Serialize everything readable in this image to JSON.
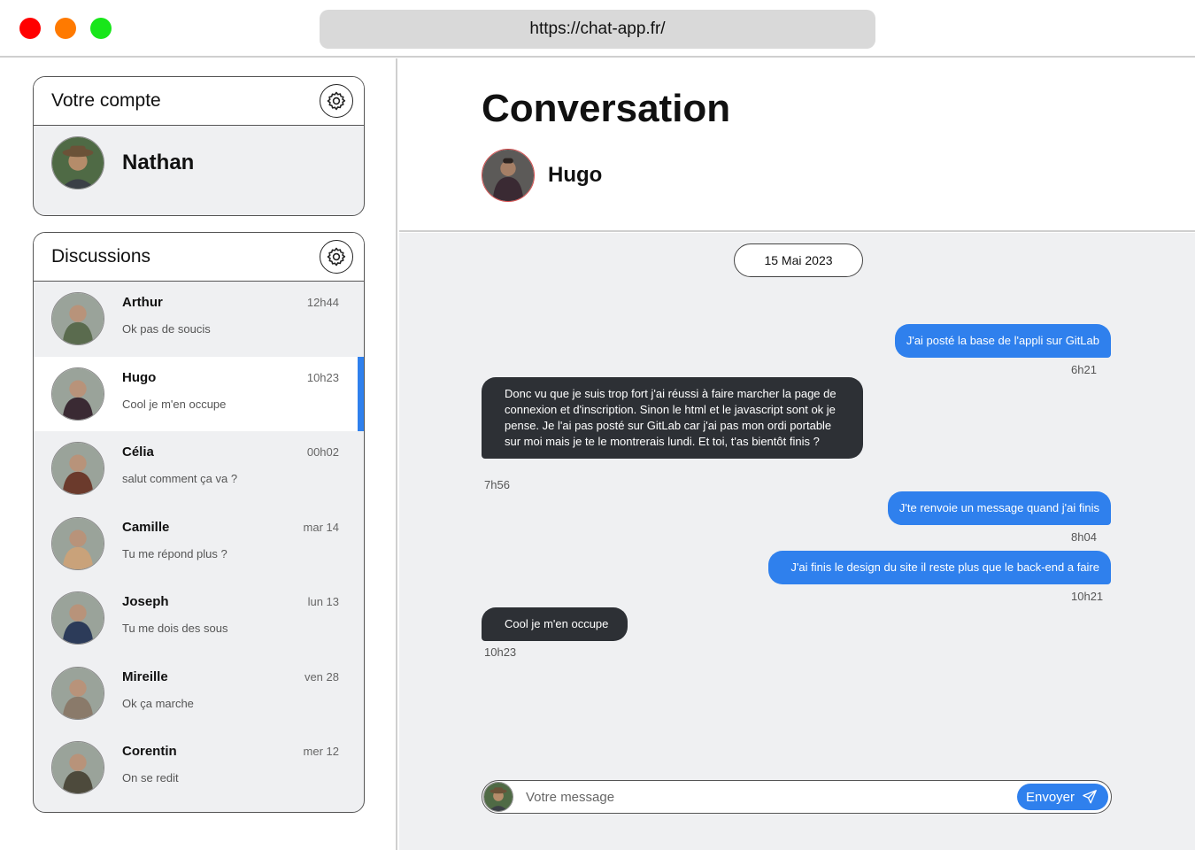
{
  "browser": {
    "url": "https://chat-app.fr/"
  },
  "account": {
    "header": "Votre compte",
    "name": "Nathan",
    "settings_icon": "gear-icon"
  },
  "discussions": {
    "header": "Discussions",
    "settings_icon": "gear-icon",
    "items": [
      {
        "name": "Arthur",
        "preview": "Ok pas de soucis",
        "time": "12h44",
        "color": "#5a6b4e"
      },
      {
        "name": "Hugo",
        "preview": "Cool je m'en occupe",
        "time": "10h23",
        "color": "#3a2a33",
        "active": true
      },
      {
        "name": "Célia",
        "preview": "salut comment ça va ?",
        "time": "00h02",
        "color": "#6b3a2c"
      },
      {
        "name": "Camille",
        "preview": "Tu me répond plus ?",
        "time": "mar 14",
        "color": "#c9a27a"
      },
      {
        "name": "Joseph",
        "preview": "Tu me dois des sous",
        "time": "lun 13",
        "color": "#2c3b59"
      },
      {
        "name": "Mireille",
        "preview": "Ok ça marche",
        "time": "ven 28",
        "color": "#8a7a6a"
      },
      {
        "name": "Corentin",
        "preview": "On se redit",
        "time": "mer 12",
        "color": "#4d4a3c"
      }
    ]
  },
  "conversation": {
    "title": "Conversation",
    "contact_name": "Hugo",
    "date": "15 Mai 2023",
    "messages": [
      {
        "from": "me",
        "text": "J'ai posté la base de l'appli sur GitLab",
        "time": "6h21"
      },
      {
        "from": "them",
        "text": "Donc vu que je suis trop fort j'ai réussi à faire marcher la page de connexion et d'inscription. Sinon le html et le javascript sont ok je pense. Je l'ai pas posté sur GitLab car j'ai pas mon ordi portable sur moi mais je te le montrerais lundi. Et toi, t'as bientôt finis ?",
        "time": "7h56"
      },
      {
        "from": "me",
        "text": "J'te renvoie un message quand j'ai finis",
        "time": "8h04"
      },
      {
        "from": "me",
        "text": "J'ai finis le design du site il reste plus que le back-end a faire",
        "time": "10h21"
      },
      {
        "from": "them",
        "text": "Cool je m'en occupe",
        "time": "10h23"
      }
    ]
  },
  "composer": {
    "placeholder": "Votre message",
    "send_label": "Envoyer",
    "send_icon": "paper-plane-icon"
  },
  "colors": {
    "accent": "#2f80ed",
    "incoming_bubble": "#2d3035",
    "panel_bg": "#eff0f2",
    "traffic_red": "#ff0000",
    "traffic_orange": "#ff7a00",
    "traffic_green": "#18e61a"
  }
}
